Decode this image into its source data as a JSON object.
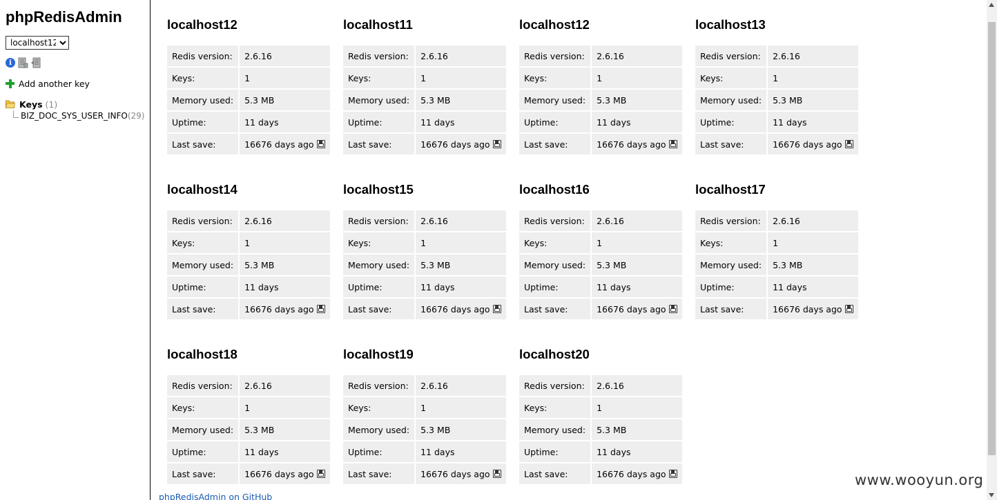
{
  "sidebar": {
    "title": "phpRedisAdmin",
    "selected_server": "localhost12",
    "icons": [
      "info-icon",
      "database-info-icon",
      "database-export-icon"
    ],
    "add_key_label": "Add another key",
    "tree": {
      "root_label": "Keys",
      "root_count": "(1)",
      "leaf_label": "BIZ_DOC_SYS_USER_INFO",
      "leaf_count": "(29)"
    }
  },
  "labels": {
    "redis_version": "Redis version:",
    "keys": "Keys:",
    "memory_used": "Memory used:",
    "uptime": "Uptime:",
    "last_save": "Last save:"
  },
  "servers": [
    {
      "name": "localhost12",
      "redis_version": "2.6.16",
      "keys": "1",
      "memory_used": "5.3 MB",
      "uptime": "11 days",
      "last_save": "16676 days ago"
    },
    {
      "name": "localhost11",
      "redis_version": "2.6.16",
      "keys": "1",
      "memory_used": "5.3 MB",
      "uptime": "11 days",
      "last_save": "16676 days ago"
    },
    {
      "name": "localhost12",
      "redis_version": "2.6.16",
      "keys": "1",
      "memory_used": "5.3 MB",
      "uptime": "11 days",
      "last_save": "16676 days ago"
    },
    {
      "name": "localhost13",
      "redis_version": "2.6.16",
      "keys": "1",
      "memory_used": "5.3 MB",
      "uptime": "11 days",
      "last_save": "16676 days ago"
    },
    {
      "name": "localhost14",
      "redis_version": "2.6.16",
      "keys": "1",
      "memory_used": "5.3 MB",
      "uptime": "11 days",
      "last_save": "16676 days ago"
    },
    {
      "name": "localhost15",
      "redis_version": "2.6.16",
      "keys": "1",
      "memory_used": "5.3 MB",
      "uptime": "11 days",
      "last_save": "16676 days ago"
    },
    {
      "name": "localhost16",
      "redis_version": "2.6.16",
      "keys": "1",
      "memory_used": "5.3 MB",
      "uptime": "11 days",
      "last_save": "16676 days ago"
    },
    {
      "name": "localhost17",
      "redis_version": "2.6.16",
      "keys": "1",
      "memory_used": "5.3 MB",
      "uptime": "11 days",
      "last_save": "16676 days ago"
    },
    {
      "name": "localhost18",
      "redis_version": "2.6.16",
      "keys": "1",
      "memory_used": "5.3 MB",
      "uptime": "11 days",
      "last_save": "16676 days ago"
    },
    {
      "name": "localhost19",
      "redis_version": "2.6.16",
      "keys": "1",
      "memory_used": "5.3 MB",
      "uptime": "11 days",
      "last_save": "16676 days ago"
    },
    {
      "name": "localhost20",
      "redis_version": "2.6.16",
      "keys": "1",
      "memory_used": "5.3 MB",
      "uptime": "11 days",
      "last_save": "16676 days ago"
    }
  ],
  "footer": {
    "github_link": "phpRedisAdmin on GitHub",
    "watermark": "www.wooyun.org"
  }
}
